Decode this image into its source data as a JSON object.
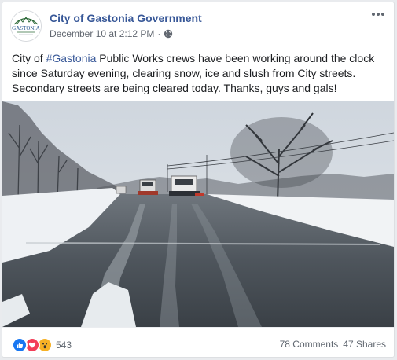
{
  "post": {
    "page_name": "City of Gastonia Government",
    "date": "December 10 at 2:12 PM",
    "separator": "·",
    "privacy_icon": "globe-icon",
    "more_icon": "more-options-icon",
    "message_before": "City of ",
    "hashtag": "#Gastonia",
    "message_after": " Public Works crews have been working around the clock since Saturday evening, clearing snow, ice and slush from City streets. Secondary streets are being cleared today. Thanks, guys and gals!",
    "logo_text": "GASTONIA"
  },
  "footer": {
    "reaction_icons": [
      "like-icon",
      "love-icon",
      "wow-icon"
    ],
    "reaction_count": "543",
    "comments": "78 Comments",
    "shares": "47 Shares"
  },
  "colors": {
    "link": "#385898",
    "like": "#1877f2",
    "love": "#f33e58",
    "wow": "#f7b125"
  }
}
